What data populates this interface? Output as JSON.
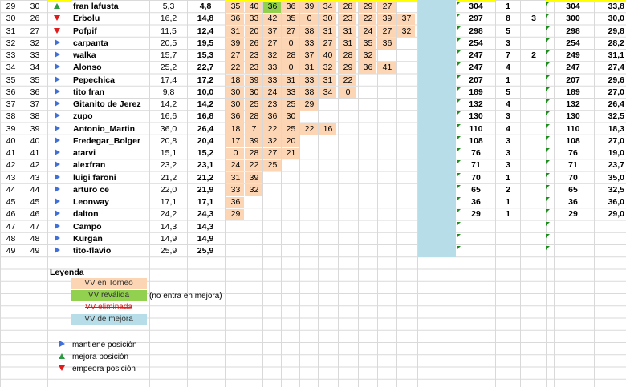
{
  "rows": [
    {
      "n": "29",
      "p": "30",
      "trend": "up",
      "name": "fran lafusta",
      "a": "5,3",
      "b": "4,8",
      "tour": [
        "35",
        "40",
        "36",
        "36",
        "39",
        "34",
        "28",
        "29",
        "27"
      ],
      "valid_idx": 2,
      "tot": "304",
      "cnt": "1",
      "extra": "",
      "t2": "304",
      "avg": "33,8"
    },
    {
      "n": "30",
      "p": "26",
      "trend": "down",
      "name": "Erbolu",
      "a": "16,2",
      "b": "14,8",
      "tour": [
        "36",
        "33",
        "42",
        "35",
        "0",
        "30",
        "23",
        "22",
        "39",
        "37"
      ],
      "tot": "297",
      "cnt": "8",
      "extra": "3",
      "t2": "300",
      "avg": "30,0"
    },
    {
      "n": "31",
      "p": "27",
      "trend": "down",
      "name": "Pofpif",
      "a": "11,5",
      "b": "12,4",
      "tour": [
        "31",
        "20",
        "37",
        "27",
        "38",
        "31",
        "31",
        "24",
        "27",
        "32"
      ],
      "tot": "298",
      "cnt": "5",
      "extra": "",
      "t2": "298",
      "avg": "29,8"
    },
    {
      "n": "32",
      "p": "32",
      "trend": "same",
      "name": "carpanta",
      "a": "20,5",
      "b": "19,5",
      "tour": [
        "39",
        "26",
        "27",
        "0",
        "33",
        "27",
        "31",
        "35",
        "36"
      ],
      "tot": "254",
      "cnt": "3",
      "extra": "",
      "t2": "254",
      "avg": "28,2"
    },
    {
      "n": "33",
      "p": "33",
      "trend": "same",
      "name": "walka",
      "a": "15,7",
      "b": "15,3",
      "tour": [
        "27",
        "23",
        "32",
        "28",
        "37",
        "40",
        "28",
        "32"
      ],
      "tot": "247",
      "cnt": "7",
      "extra": "2",
      "t2": "249",
      "avg": "31,1"
    },
    {
      "n": "34",
      "p": "34",
      "trend": "same",
      "name": "Alonso",
      "a": "25,2",
      "b": "22,7",
      "tour": [
        "22",
        "23",
        "33",
        "0",
        "31",
        "32",
        "29",
        "36",
        "41"
      ],
      "tot": "247",
      "cnt": "4",
      "extra": "",
      "t2": "247",
      "avg": "27,4"
    },
    {
      "n": "35",
      "p": "35",
      "trend": "same",
      "name": "Pepechica",
      "a": "17,4",
      "b": "17,2",
      "tour": [
        "18",
        "39",
        "33",
        "31",
        "33",
        "31",
        "22"
      ],
      "tot": "207",
      "cnt": "1",
      "extra": "",
      "t2": "207",
      "avg": "29,6"
    },
    {
      "n": "36",
      "p": "36",
      "trend": "same",
      "name": "tito fran",
      "a": "9,8",
      "b": "10,0",
      "tour": [
        "30",
        "30",
        "24",
        "33",
        "38",
        "34",
        "0"
      ],
      "tot": "189",
      "cnt": "5",
      "extra": "",
      "t2": "189",
      "avg": "27,0"
    },
    {
      "n": "37",
      "p": "37",
      "trend": "same",
      "name": "Gitanito de Jerez",
      "a": "14,2",
      "b": "14,2",
      "tour": [
        "30",
        "25",
        "23",
        "25",
        "29"
      ],
      "tot": "132",
      "cnt": "4",
      "extra": "",
      "t2": "132",
      "avg": "26,4"
    },
    {
      "n": "38",
      "p": "38",
      "trend": "same",
      "name": "zupo",
      "a": "16,6",
      "b": "16,8",
      "tour": [
        "36",
        "28",
        "36",
        "30"
      ],
      "tot": "130",
      "cnt": "3",
      "extra": "",
      "t2": "130",
      "avg": "32,5"
    },
    {
      "n": "39",
      "p": "39",
      "trend": "same",
      "name": "Antonio_Martin",
      "a": "36,0",
      "b": "26,4",
      "tour": [
        "18",
        "7",
        "22",
        "25",
        "22",
        "16"
      ],
      "tot": "110",
      "cnt": "4",
      "extra": "",
      "t2": "110",
      "avg": "18,3"
    },
    {
      "n": "40",
      "p": "40",
      "trend": "same",
      "name": "Fredegar_Bolger",
      "a": "20,8",
      "b": "20,4",
      "tour": [
        "17",
        "39",
        "32",
        "20"
      ],
      "tot": "108",
      "cnt": "3",
      "extra": "",
      "t2": "108",
      "avg": "27,0"
    },
    {
      "n": "41",
      "p": "41",
      "trend": "same",
      "name": "atarvi",
      "a": "15,1",
      "b": "15,2",
      "tour": [
        "0",
        "28",
        "27",
        "21"
      ],
      "tot": "76",
      "cnt": "3",
      "extra": "",
      "t2": "76",
      "avg": "19,0"
    },
    {
      "n": "42",
      "p": "42",
      "trend": "same",
      "name": "alexfran",
      "a": "23,2",
      "b": "23,1",
      "tour": [
        "24",
        "22",
        "25"
      ],
      "tot": "71",
      "cnt": "3",
      "extra": "",
      "t2": "71",
      "avg": "23,7"
    },
    {
      "n": "43",
      "p": "43",
      "trend": "same",
      "name": "luigi faroni",
      "a": "21,2",
      "b": "21,2",
      "tour": [
        "31",
        "39"
      ],
      "tot": "70",
      "cnt": "1",
      "extra": "",
      "t2": "70",
      "avg": "35,0"
    },
    {
      "n": "44",
      "p": "44",
      "trend": "same",
      "name": "arturo ce",
      "a": "22,0",
      "b": "21,9",
      "tour": [
        "33",
        "32"
      ],
      "tot": "65",
      "cnt": "2",
      "extra": "",
      "t2": "65",
      "avg": "32,5"
    },
    {
      "n": "45",
      "p": "45",
      "trend": "same",
      "name": "Leonway",
      "a": "17,1",
      "b": "17,1",
      "tour": [
        "36"
      ],
      "tot": "36",
      "cnt": "1",
      "extra": "",
      "t2": "36",
      "avg": "36,0"
    },
    {
      "n": "46",
      "p": "46",
      "trend": "same",
      "name": "dalton",
      "a": "24,2",
      "b": "24,3",
      "tour": [
        "29"
      ],
      "tot": "29",
      "cnt": "1",
      "extra": "",
      "t2": "29",
      "avg": "29,0"
    },
    {
      "n": "47",
      "p": "47",
      "trend": "same",
      "name": "Campo",
      "a": "14,3",
      "b": "14,3",
      "tour": [],
      "tot": "",
      "cnt": "",
      "extra": "",
      "t2": "",
      "avg": ""
    },
    {
      "n": "48",
      "p": "48",
      "trend": "same",
      "name": "Kurgan",
      "a": "14,9",
      "b": "14,9",
      "tour": [],
      "tot": "",
      "cnt": "",
      "extra": "",
      "t2": "",
      "avg": ""
    },
    {
      "n": "49",
      "p": "49",
      "trend": "same",
      "name": "tito-flavio",
      "a": "25,9",
      "b": "25,9",
      "tour": [],
      "tot": "",
      "cnt": "",
      "extra": "",
      "t2": "",
      "avg": ""
    }
  ],
  "legend": {
    "title": "Leyenda",
    "en_torneo": "VV en Torneo",
    "revalida": "VV reválida",
    "revalida_note": "(no entra en mejora)",
    "eliminada": "VV eliminada",
    "de_mejora": "VV de mejora",
    "mantiene": "mantiene posición",
    "mejora": "mejora posición",
    "empeora": "empeora posición"
  },
  "colors": {
    "tourney": "#fcd5b4",
    "valid": "#92d050",
    "mejora_col": "#b7dde8",
    "up": "#2e9a44",
    "down": "#e01b1b",
    "same": "#3f6fd8"
  }
}
